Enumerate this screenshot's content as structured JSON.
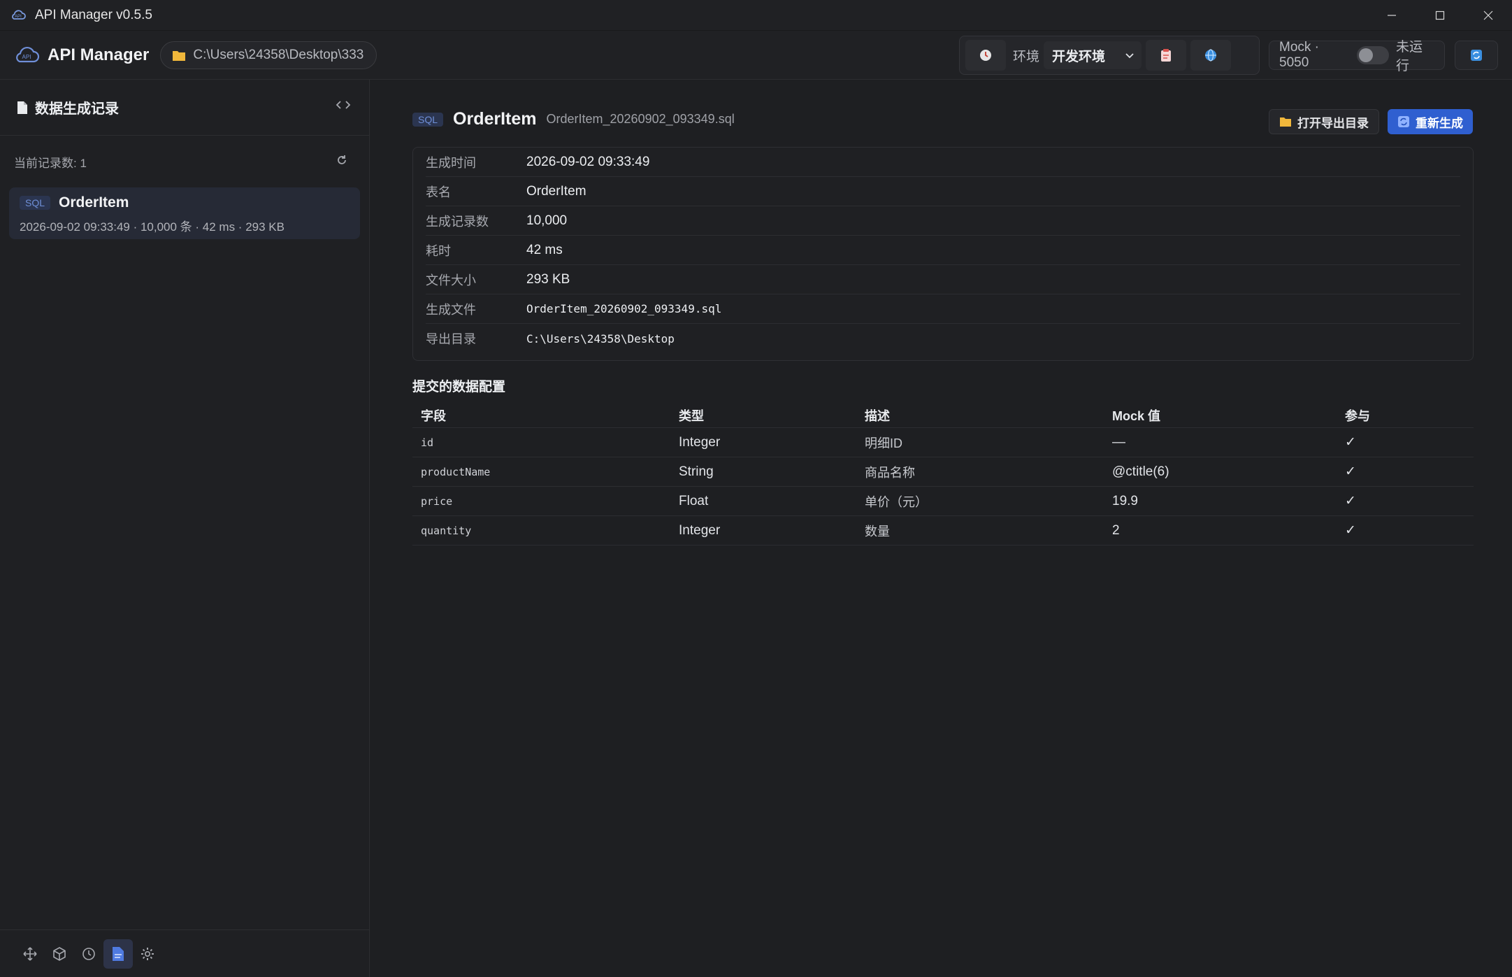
{
  "window": {
    "title": "API Manager v0.5.5"
  },
  "header": {
    "brand": "API Manager",
    "path": "C:\\Users\\24358\\Desktop\\333",
    "env_label": "环境",
    "env_value": "开发环境",
    "mock_label": "Mock · 5050",
    "mock_status": "未运行"
  },
  "sidebar": {
    "title": "数据生成记录",
    "count_text": "当前记录数: 1",
    "records": [
      {
        "badge": "SQL",
        "name": "OrderItem",
        "meta": "2026-09-02 09:33:49 · 10,000 条 · 42 ms · 293 KB"
      }
    ]
  },
  "main": {
    "badge": "SQL",
    "title": "OrderItem",
    "file": "OrderItem_20260902_093349.sql",
    "open_dir_button": "打开导出目录",
    "regen_button": "重新生成",
    "info": [
      {
        "k": "生成时间",
        "v": "2026-09-02 09:33:49"
      },
      {
        "k": "表名",
        "v": "OrderItem"
      },
      {
        "k": "生成记录数",
        "v": "10,000"
      },
      {
        "k": "耗时",
        "v": "42 ms"
      },
      {
        "k": "文件大小",
        "v": "293 KB"
      },
      {
        "k": "生成文件",
        "v": "OrderItem_20260902_093349.sql"
      },
      {
        "k": "导出目录",
        "v": "C:\\Users\\24358\\Desktop"
      }
    ],
    "config_title": "提交的数据配置",
    "columns": [
      "字段",
      "类型",
      "描述",
      "Mock 值",
      "参与"
    ],
    "rows": [
      {
        "field": "id",
        "type": "Integer",
        "desc": "明细ID",
        "mock": "—",
        "on": "✓"
      },
      {
        "field": "productName",
        "type": "String",
        "desc": "商品名称",
        "mock": "@ctitle(6)",
        "on": "✓"
      },
      {
        "field": "price",
        "type": "Float",
        "desc": "单价（元）",
        "mock": "19.9",
        "on": "✓"
      },
      {
        "field": "quantity",
        "type": "Integer",
        "desc": "数量",
        "mock": "2",
        "on": "✓"
      }
    ]
  },
  "colors": {
    "accent": "#2f5fd0",
    "background": "#1e1f22",
    "panel": "#202124"
  }
}
